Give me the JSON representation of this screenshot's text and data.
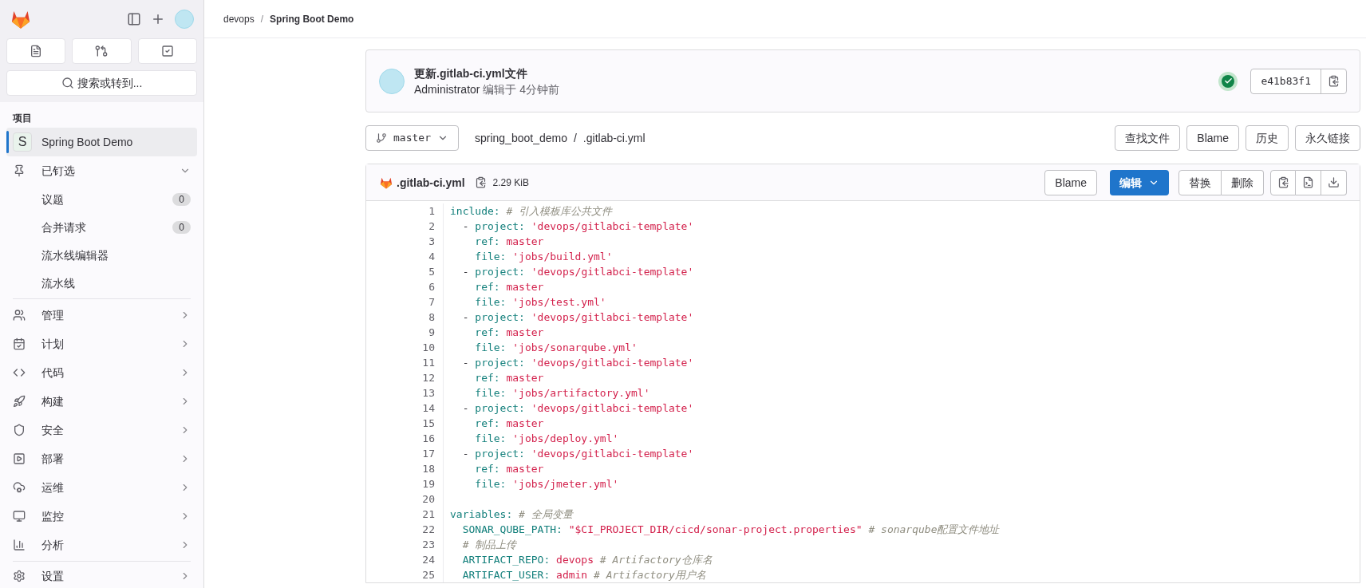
{
  "sidebar": {
    "search": {
      "placeholder": "搜索或转到..."
    },
    "section_title": "项目",
    "project": {
      "initial": "S",
      "name": "Spring Boot Demo",
      "selected": true
    },
    "pinned": {
      "label": "已钉选",
      "expanded": true,
      "items": [
        {
          "label": "议题",
          "count": "0"
        },
        {
          "label": "合并请求",
          "count": "0"
        },
        {
          "label": "流水线编辑器"
        },
        {
          "label": "流水线"
        }
      ]
    },
    "menu": [
      {
        "label": "管理"
      },
      {
        "label": "计划"
      },
      {
        "label": "代码"
      },
      {
        "label": "构建"
      },
      {
        "label": "安全"
      },
      {
        "label": "部署"
      },
      {
        "label": "运维"
      },
      {
        "label": "监控"
      },
      {
        "label": "分析"
      }
    ],
    "settings": {
      "label": "设置"
    }
  },
  "breadcrumb": {
    "separator": "/",
    "items": [
      "devops",
      "Spring Boot Demo"
    ]
  },
  "commit": {
    "title": "更新.gitlab-ci.yml文件",
    "author": "Administrator",
    "meta": "编辑于 4分钟前",
    "pipeline_passed": true,
    "sha": "e41b83f1"
  },
  "branch": "master",
  "path": {
    "separator": "/",
    "items": [
      "spring_boot_demo",
      ".gitlab-ci.yml"
    ]
  },
  "actions": [
    "查找文件",
    "Blame",
    "历史",
    "永久链接"
  ],
  "file": {
    "name": ".gitlab-ci.yml",
    "size": "2.29 KiB",
    "blame": "Blame",
    "edit": "编辑",
    "group": [
      "替换",
      "删除"
    ],
    "lines": [
      {
        "number": "1",
        "tokens": [
          {
            "kind": "key",
            "text": "include: "
          },
          {
            "kind": "comment",
            "text": "# 引入模板库公共文件"
          }
        ]
      },
      {
        "number": "2",
        "tokens": [
          {
            "kind": "plain",
            "text": "  - "
          },
          {
            "kind": "key",
            "text": "project: "
          },
          {
            "kind": "string",
            "text": "'devops/gitlabci-template'"
          }
        ]
      },
      {
        "number": "3",
        "tokens": [
          {
            "kind": "key",
            "text": "    ref: "
          },
          {
            "kind": "string",
            "text": "master"
          }
        ]
      },
      {
        "number": "4",
        "tokens": [
          {
            "kind": "key",
            "text": "    file: "
          },
          {
            "kind": "string",
            "text": "'jobs/build.yml'"
          }
        ]
      },
      {
        "number": "5",
        "tokens": [
          {
            "kind": "plain",
            "text": "  - "
          },
          {
            "kind": "key",
            "text": "project: "
          },
          {
            "kind": "string",
            "text": "'devops/gitlabci-template'"
          }
        ]
      },
      {
        "number": "6",
        "tokens": [
          {
            "kind": "key",
            "text": "    ref: "
          },
          {
            "kind": "string",
            "text": "master"
          }
        ]
      },
      {
        "number": "7",
        "tokens": [
          {
            "kind": "key",
            "text": "    file: "
          },
          {
            "kind": "string",
            "text": "'jobs/test.yml'"
          }
        ]
      },
      {
        "number": "8",
        "tokens": [
          {
            "kind": "plain",
            "text": "  - "
          },
          {
            "kind": "key",
            "text": "project: "
          },
          {
            "kind": "string",
            "text": "'devops/gitlabci-template'"
          }
        ]
      },
      {
        "number": "9",
        "tokens": [
          {
            "kind": "key",
            "text": "    ref: "
          },
          {
            "kind": "string",
            "text": "master"
          }
        ]
      },
      {
        "number": "10",
        "tokens": [
          {
            "kind": "key",
            "text": "    file: "
          },
          {
            "kind": "string",
            "text": "'jobs/sonarqube.yml'"
          }
        ]
      },
      {
        "number": "11",
        "tokens": [
          {
            "kind": "plain",
            "text": "  - "
          },
          {
            "kind": "key",
            "text": "project: "
          },
          {
            "kind": "string",
            "text": "'devops/gitlabci-template'"
          }
        ]
      },
      {
        "number": "12",
        "tokens": [
          {
            "kind": "key",
            "text": "    ref: "
          },
          {
            "kind": "string",
            "text": "master"
          }
        ]
      },
      {
        "number": "13",
        "tokens": [
          {
            "kind": "key",
            "text": "    file: "
          },
          {
            "kind": "string",
            "text": "'jobs/artifactory.yml'"
          }
        ]
      },
      {
        "number": "14",
        "tokens": [
          {
            "kind": "plain",
            "text": "  - "
          },
          {
            "kind": "key",
            "text": "project: "
          },
          {
            "kind": "string",
            "text": "'devops/gitlabci-template'"
          }
        ]
      },
      {
        "number": "15",
        "tokens": [
          {
            "kind": "key",
            "text": "    ref: "
          },
          {
            "kind": "string",
            "text": "master"
          }
        ]
      },
      {
        "number": "16",
        "tokens": [
          {
            "kind": "key",
            "text": "    file: "
          },
          {
            "kind": "string",
            "text": "'jobs/deploy.yml'"
          }
        ]
      },
      {
        "number": "17",
        "tokens": [
          {
            "kind": "plain",
            "text": "  - "
          },
          {
            "kind": "key",
            "text": "project: "
          },
          {
            "kind": "string",
            "text": "'devops/gitlabci-template'"
          }
        ]
      },
      {
        "number": "18",
        "tokens": [
          {
            "kind": "key",
            "text": "    ref: "
          },
          {
            "kind": "string",
            "text": "master"
          }
        ]
      },
      {
        "number": "19",
        "tokens": [
          {
            "kind": "key",
            "text": "    file: "
          },
          {
            "kind": "string",
            "text": "'jobs/jmeter.yml'"
          }
        ]
      },
      {
        "number": "20"
      },
      {
        "number": "21",
        "tokens": [
          {
            "kind": "key",
            "text": "variables: "
          },
          {
            "kind": "comment",
            "text": "# 全局变量"
          }
        ]
      },
      {
        "number": "22",
        "tokens": [
          {
            "kind": "key",
            "text": "  SONAR_QUBE_PATH: "
          },
          {
            "kind": "string",
            "text": "\"$CI_PROJECT_DIR/cicd/sonar-project.properties\" "
          },
          {
            "kind": "comment",
            "text": "# sonarqube配置文件地址"
          }
        ]
      },
      {
        "number": "23",
        "tokens": [
          {
            "kind": "comment",
            "text": "  # 制品上传"
          }
        ]
      },
      {
        "number": "24",
        "tokens": [
          {
            "kind": "key",
            "text": "  ARTIFACT_REPO: "
          },
          {
            "kind": "string",
            "text": "devops "
          },
          {
            "kind": "comment",
            "text": "# Artifactory仓库名"
          }
        ]
      },
      {
        "number": "25",
        "tokens": [
          {
            "kind": "key",
            "text": "  ARTIFACT_USER: "
          },
          {
            "kind": "string",
            "text": "admin "
          },
          {
            "kind": "comment",
            "text": "# Artifactory用户名"
          }
        ]
      }
    ]
  }
}
